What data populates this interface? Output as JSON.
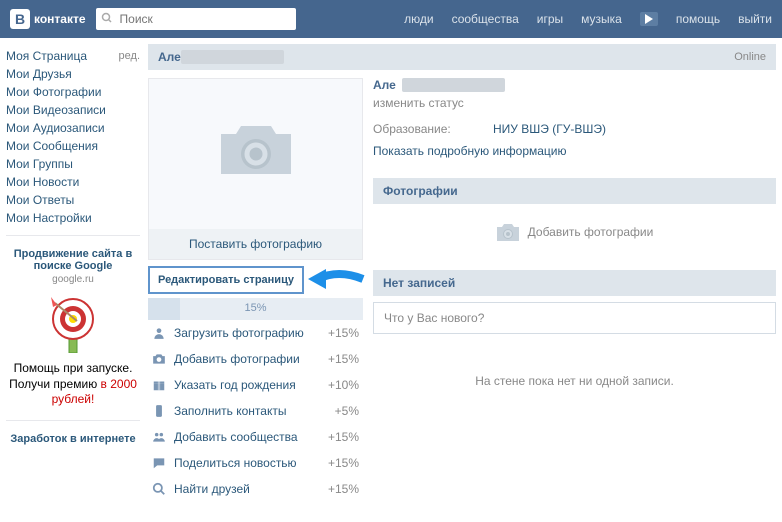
{
  "header": {
    "brand": "контакте",
    "search_placeholder": "Поиск",
    "nav": {
      "people": "люди",
      "communities": "сообщества",
      "games": "игры",
      "music": "музыка",
      "help": "помощь",
      "exit": "выйти"
    }
  },
  "sidebar": {
    "my_page": "Моя Страница",
    "edit": "ред.",
    "friends": "Мои Друзья",
    "photos": "Мои Фотографии",
    "videos": "Мои Видеозаписи",
    "audio": "Мои Аудиозаписи",
    "messages": "Мои Сообщения",
    "groups": "Мои Группы",
    "news": "Мои Новости",
    "answers": "Мои Ответы",
    "settings": "Мои Настройки"
  },
  "promo1": {
    "title": "Продвижение сайта в поиске Google",
    "sub": "google.ru",
    "text_plain": "Помощь при запуске. Получи премию ",
    "text_red": "в 2000 рублей!"
  },
  "promo2": {
    "title": "Заработок в интернете"
  },
  "profile": {
    "name_prefix": "Але",
    "online": "Online",
    "status": "изменить статус",
    "edu_label": "Образование:",
    "edu_value": "НИУ ВШЭ (ГУ-ВШЭ)",
    "more": "Показать подробную информацию"
  },
  "photo_block": {
    "set_photo": "Поставить фотографию",
    "edit_page": "Редактировать страницу",
    "progress": "15%"
  },
  "tasks": [
    {
      "icon": "user",
      "label": "Загрузить фотографию",
      "pct": "+15%"
    },
    {
      "icon": "camera",
      "label": "Добавить фотографии",
      "pct": "+15%"
    },
    {
      "icon": "gift",
      "label": "Указать год рождения",
      "pct": "+10%"
    },
    {
      "icon": "phone",
      "label": "Заполнить контакты",
      "pct": "+5%"
    },
    {
      "icon": "group",
      "label": "Добавить сообщества",
      "pct": "+15%"
    },
    {
      "icon": "chat",
      "label": "Поделиться новостью",
      "pct": "+15%"
    },
    {
      "icon": "search",
      "label": "Найти друзей",
      "pct": "+15%"
    }
  ],
  "sections": {
    "photos": "Фотографии",
    "add_photos": "Добавить фотографии",
    "no_posts": "Нет записей",
    "wall_placeholder": "Что у Вас нового?",
    "empty_wall": "На стене пока нет ни одной записи."
  }
}
